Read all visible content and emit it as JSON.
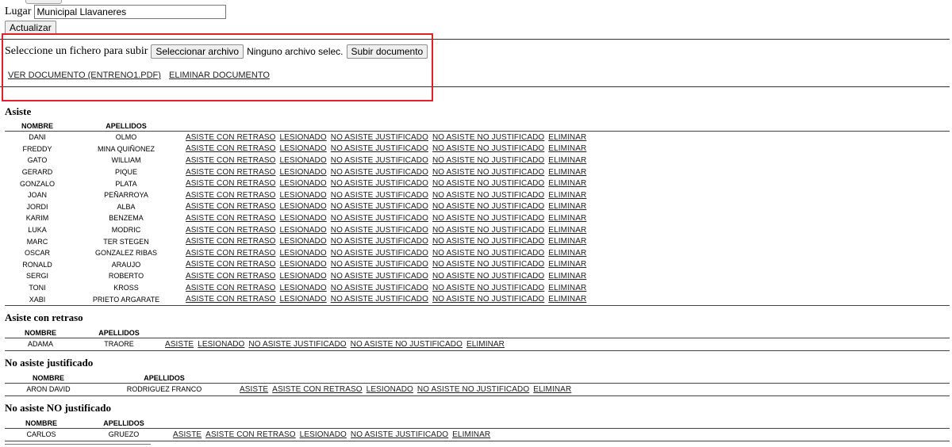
{
  "lugar": {
    "label": "Lugar",
    "value": "Municipal Llavaneres"
  },
  "actualizar_label": "Actualizar",
  "upload": {
    "prompt": "Seleccione un fichero para subir",
    "select_label": "Seleccionar archivo",
    "no_file": "Ninguno archivo selec.",
    "submit_label": "Subir documento"
  },
  "document_links": {
    "view": "VER DOCUMENTO (ENTRENO1.PDF)",
    "delete": "ELIMINAR DOCUMENTO"
  },
  "headers": {
    "nombre": "NOMBRE",
    "apellidos": "APELLIDOS"
  },
  "sections": {
    "asiste": {
      "title": "Asiste",
      "actions": [
        "ASISTE CON RETRASO",
        "LESIONADO",
        "NO ASISTE JUSTIFICADO",
        "NO ASISTE NO JUSTIFICADO",
        "ELIMINAR"
      ],
      "rows": [
        {
          "nombre": "DANI",
          "apellidos": "OLMO"
        },
        {
          "nombre": "FREDDY",
          "apellidos": "MINA QUIÑONEZ"
        },
        {
          "nombre": "GATO",
          "apellidos": "WILLIAM"
        },
        {
          "nombre": "GERARD",
          "apellidos": "PIQUE"
        },
        {
          "nombre": "GONZALO",
          "apellidos": "PLATA"
        },
        {
          "nombre": "JOAN",
          "apellidos": "PEÑARROYA"
        },
        {
          "nombre": "JORDI",
          "apellidos": "ALBA"
        },
        {
          "nombre": "KARIM",
          "apellidos": "BENZEMA"
        },
        {
          "nombre": "LUKA",
          "apellidos": "MODRIC"
        },
        {
          "nombre": "MARC",
          "apellidos": "TER STEGEN"
        },
        {
          "nombre": "OSCAR",
          "apellidos": "GONZALEZ RIBAS"
        },
        {
          "nombre": "RONALD",
          "apellidos": "ARAUJO"
        },
        {
          "nombre": "SERGI",
          "apellidos": "ROBERTO"
        },
        {
          "nombre": "TONI",
          "apellidos": "KROSS"
        },
        {
          "nombre": "XABI",
          "apellidos": "PRIETO ARGARATE"
        }
      ]
    },
    "retraso": {
      "title": "Asiste con retraso",
      "actions": [
        "ASISTE",
        "LESIONADO",
        "NO ASISTE JUSTIFICADO",
        "NO ASISTE NO JUSTIFICADO",
        "ELIMINAR"
      ],
      "rows": [
        {
          "nombre": "ADAMA",
          "apellidos": "TRAORE"
        }
      ]
    },
    "justificado": {
      "title": "No asiste justificado",
      "actions": [
        "ASISTE",
        "ASISTE CON RETRASO",
        "LESIONADO",
        "NO ASISTE NO JUSTIFICADO",
        "ELIMINAR"
      ],
      "rows": [
        {
          "nombre": "ARON DAVID",
          "apellidos": "RODRIGUEZ FRANCO"
        }
      ]
    },
    "no_justificado": {
      "title": "No asiste NO justificado",
      "actions": [
        "ASISTE",
        "ASISTE CON RETRASO",
        "LESIONADO",
        "NO ASISTE JUSTIFICADO",
        "ELIMINAR"
      ],
      "rows": [
        {
          "nombre": "CARLOS",
          "apellidos": "GRUEZO"
        }
      ]
    }
  },
  "colors": {
    "annotation_box": "#e0202a"
  }
}
